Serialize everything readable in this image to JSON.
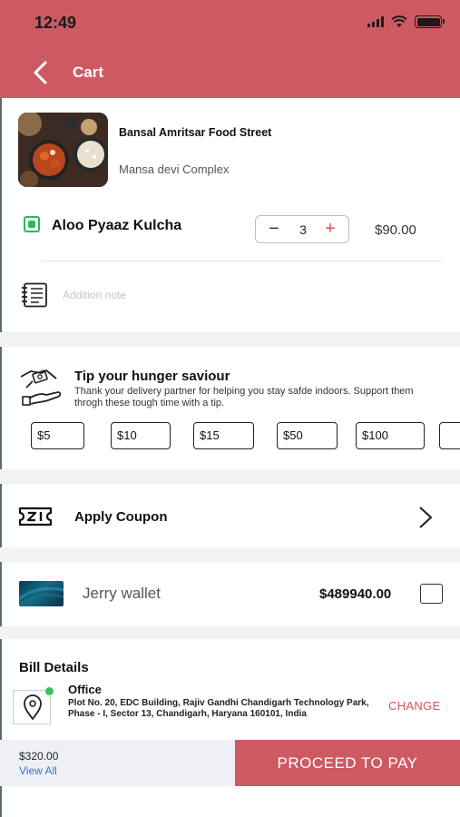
{
  "status_bar": {
    "time": "12:49"
  },
  "header": {
    "title": "Cart"
  },
  "restaurant": {
    "name": "Bansal Amritsar Food Street",
    "address": "Mansa devi Complex"
  },
  "cart_item": {
    "name": "Aloo Pyaaz Kulcha",
    "quantity": "3",
    "minus": "−",
    "plus": "+",
    "price": "$90.00"
  },
  "note": {
    "placeholder": "Addition note"
  },
  "tip": {
    "title": "Tip your hunger saviour",
    "description": "Thank your delivery partner for helping you stay safde indoors. Support them throgh these tough time with a tip.",
    "amounts": [
      "$5",
      "$10",
      "$15",
      "$50",
      "$100"
    ]
  },
  "coupon": {
    "label": "Apply Coupon"
  },
  "wallet": {
    "label": "Jerry wallet",
    "balance": "$489940.00"
  },
  "bill": {
    "title": "Bill Details",
    "address_type": "Office",
    "address": "Plot No. 20, EDC Building, Rajiv Gandhi Chandigarh Technology Park, Phase - I, Sector 13, Chandigarh, Haryana 160101, India",
    "change_label": "CHANGE"
  },
  "footer": {
    "total": "$320.00",
    "view_all": "View All",
    "pay_label": "PROCEED TO PAY"
  },
  "colors": {
    "accent": "#cd5a63",
    "veg": "#2fb65b",
    "link": "#3a72c9"
  }
}
